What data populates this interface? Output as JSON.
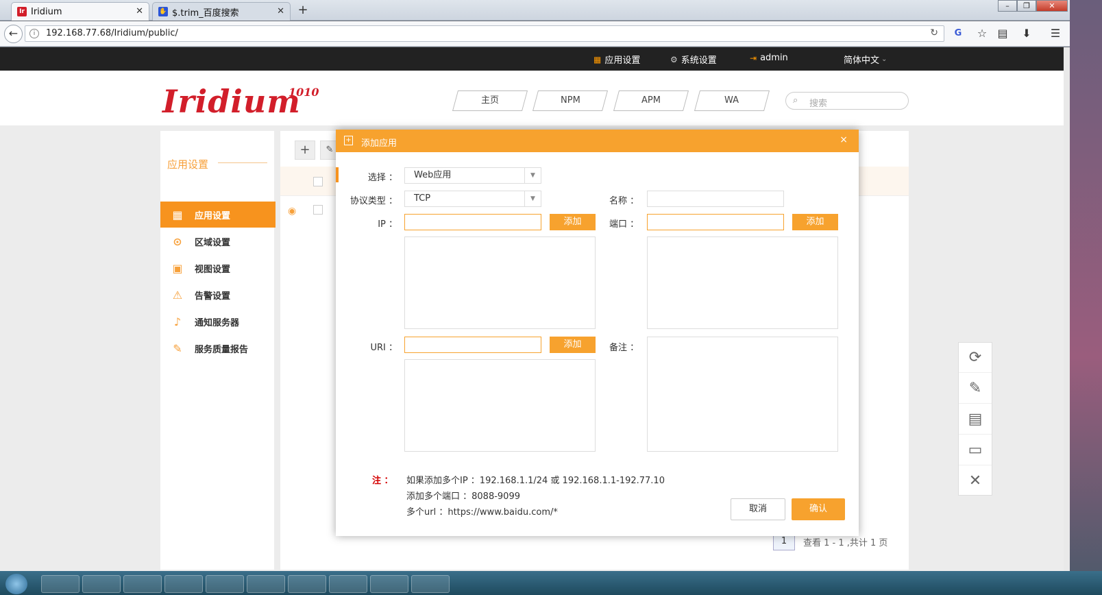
{
  "browser": {
    "tabs": [
      {
        "title": "Iridium",
        "favicon": "iridium-favicon"
      },
      {
        "title": "$.trim_百度搜索",
        "favicon": "baidu-favicon"
      }
    ],
    "new_tab": "+",
    "url": "192.168.77.68/Iridium/public/"
  },
  "topbar": {
    "app_settings": "应用设置",
    "system_settings": "系统设置",
    "user": "admin",
    "language": "简体中文"
  },
  "header": {
    "logo": "Iridium",
    "logo_suffix": "1010",
    "nav": [
      "主页",
      "NPM",
      "APM",
      "WA"
    ],
    "search_placeholder": "搜索"
  },
  "sidebar": {
    "title": "应用设置",
    "items": [
      {
        "label": "应用设置",
        "icon": "grid-icon",
        "active": true
      },
      {
        "label": "区域设置",
        "icon": "location-pin-icon",
        "active": false
      },
      {
        "label": "视图设置",
        "icon": "image-icon",
        "active": false
      },
      {
        "label": "告警设置",
        "icon": "warning-triangle-icon",
        "active": false
      },
      {
        "label": "通知服务器",
        "icon": "speaker-icon",
        "active": false
      },
      {
        "label": "服务质量报告",
        "icon": "edit-report-icon",
        "active": false
      }
    ]
  },
  "pager": {
    "current_page": "1",
    "summary": "查看 1 - 1 ,共计 1 页"
  },
  "modal": {
    "title": "添加应用",
    "close": "×",
    "select_label": "选择 ：",
    "select_value": "Web应用",
    "protocol_label": "协议类型 ：",
    "protocol_value": "TCP",
    "name_label": "名称 ：",
    "ip_label": "IP ：",
    "port_label": "端口 ：",
    "uri_label": "URI ：",
    "remark_label": "备注 ：",
    "add_label": "添加",
    "note_label": "注 ：",
    "notes": [
      "如果添加多个IP ：192.168.1.1/24 或 192.168.1.1-192.77.10",
      "添加多个端口 ：8088-9099",
      "多个url ：https://www.baidu.com/*"
    ],
    "cancel": "取消",
    "confirm": "确认"
  },
  "colors": {
    "accent": "#f7a22e",
    "active_sidebar": "#f7931e",
    "topbar": "#222222",
    "logo": "#d21e2a"
  }
}
